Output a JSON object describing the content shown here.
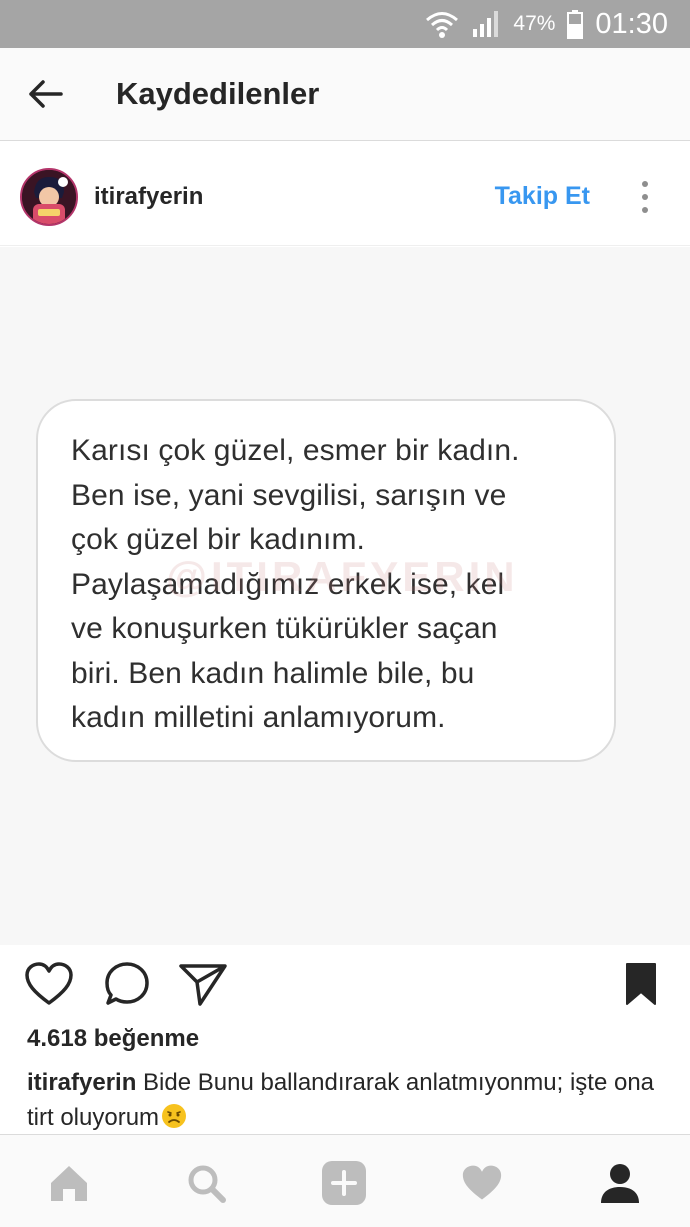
{
  "status_bar": {
    "battery_percent": "47%",
    "time": "01:30",
    "icons": [
      "wifi-icon",
      "signal-icon",
      "battery-icon"
    ]
  },
  "header": {
    "title": "Kaydedilenler",
    "back_icon": "arrow-left-icon"
  },
  "post": {
    "username": "itirafyerin",
    "follow_label": "Takip Et",
    "more_icon": "more-vertical-icon",
    "image_text": [
      "Karısı çok güzel, esmer bir kadın.",
      "Ben ise, yani sevgilisi, sarışın ve",
      "çok güzel bir kadınım.",
      "Paylaşamadığımız erkek ise, kel",
      "ve konuşurken tükürükler saçan",
      "biri. Ben kadın halimle bile, bu",
      "kadın milletini anlamıyorum."
    ],
    "watermark": "@ITIRAFYERIN",
    "actions": [
      "heart-icon",
      "comment-icon",
      "share-icon",
      "bookmark-icon"
    ],
    "likes": "4.618 beğenme",
    "caption_user": "itirafyerin",
    "caption_text": " Bide Bunu ballandırarak anlatmıyonmu; işte ona tirt oluyorum"
  },
  "bottom_nav": {
    "items": [
      "home-icon",
      "search-icon",
      "add-icon",
      "activity-icon",
      "profile-icon"
    ]
  },
  "colors": {
    "status_bar": "#a5a5a5",
    "accent": "#3897f0",
    "text": "#262626",
    "icon_inactive": "#bdbdbd"
  }
}
